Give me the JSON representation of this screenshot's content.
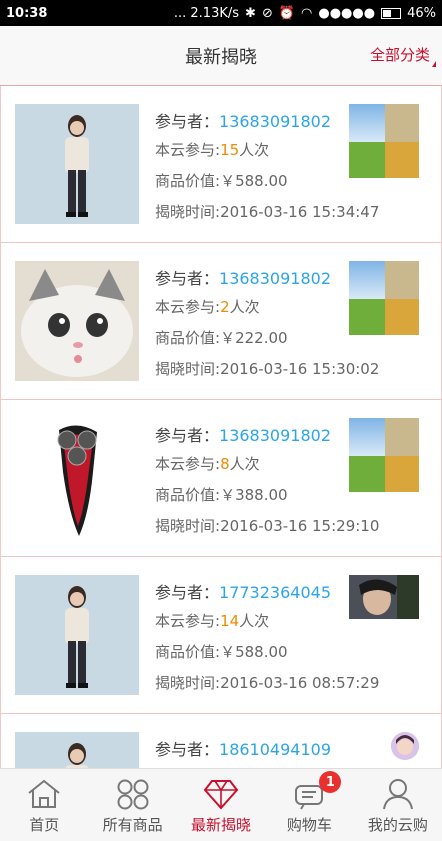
{
  "status": {
    "time": "10:38",
    "speed": "... 2.13K/s",
    "battery": "46%"
  },
  "header": {
    "title": "最新揭晓",
    "category": "全部分类"
  },
  "labels": {
    "participant": "参与者：",
    "cloud_prefix": "本云参与:",
    "cloud_suffix": "人次",
    "value_prefix": "商品价值:",
    "time_prefix": "揭晓时间:"
  },
  "items": [
    {
      "phone": "13683091802",
      "count": "15",
      "value": "￥588.00",
      "time": "2016-03-16 15:34:47"
    },
    {
      "phone": "13683091802",
      "count": "2",
      "value": "￥222.00",
      "time": "2016-03-16 15:30:02"
    },
    {
      "phone": "13683091802",
      "count": "8",
      "value": "￥388.00",
      "time": "2016-03-16 15:29:10"
    },
    {
      "phone": "17732364045",
      "count": "14",
      "value": "￥588.00",
      "time": "2016-03-16 08:57:29"
    },
    {
      "phone": "18610494109"
    }
  ],
  "tabs": [
    {
      "label": "首页"
    },
    {
      "label": "所有商品"
    },
    {
      "label": "最新揭晓"
    },
    {
      "label": "购物车",
      "badge": "1"
    },
    {
      "label": "我的云购"
    }
  ],
  "colors": {
    "accent": "#c8102e",
    "phone": "#2ba5e8",
    "count": "#f08a00"
  }
}
